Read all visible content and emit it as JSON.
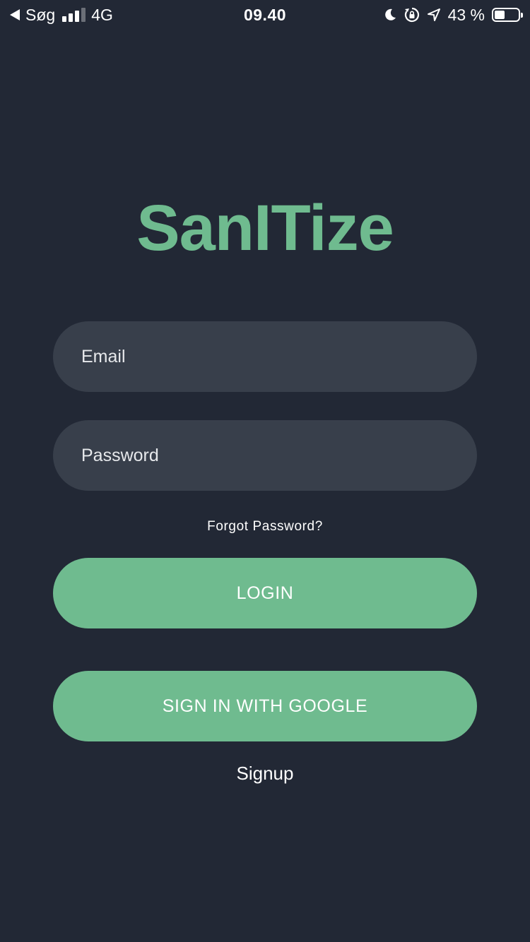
{
  "status_bar": {
    "back_icon": "back-triangle-icon",
    "back_label": "Søg",
    "network": "4G",
    "time": "09.40",
    "battery_text": "43 %",
    "battery_level": 0.43,
    "icons": [
      "moon-icon",
      "rotation-lock-icon",
      "location-arrow-icon",
      "battery-icon"
    ]
  },
  "app": {
    "title": "SanITize",
    "accent_color": "#6fbb8f",
    "background_color": "#222835",
    "field_color": "#383f4b"
  },
  "form": {
    "email_placeholder": "Email",
    "password_placeholder": "Password",
    "forgot_label": "Forgot Password?",
    "login_label": "LOGIN",
    "google_label": "SIGN IN WITH GOOGLE",
    "signup_label": "Signup"
  }
}
